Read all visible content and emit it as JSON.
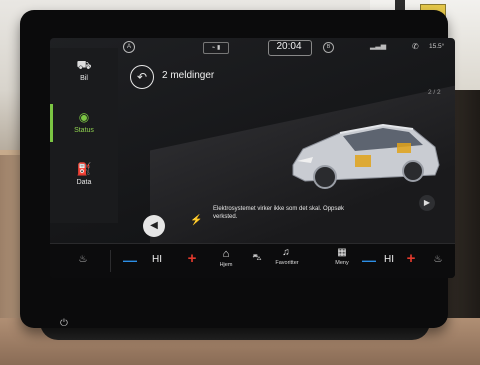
{
  "sidebar": {
    "items": [
      {
        "label": "Bil",
        "icon": "car-lift-icon"
      },
      {
        "label": "Status",
        "icon": "status-car-icon"
      },
      {
        "label": "Data",
        "icon": "data-icon"
      }
    ]
  },
  "status_bar": {
    "left_badge": "A",
    "clock": "20:04",
    "right_badge": "B",
    "outside_temp": "15.5°"
  },
  "header": {
    "title": "2 meldinger",
    "pager": "2 / 2"
  },
  "warning": {
    "text": "Elektrosystemet virker ikke som det skal. Oppsøk verksted."
  },
  "bottom_bar": {
    "left_fan": "HI",
    "right_fan": "HI",
    "home_label": "Hjem",
    "favorites_label": "Favoritter",
    "menu_label": "Meny"
  },
  "colors": {
    "accent_green": "#7bc543",
    "warning_amber": "#e0a21a",
    "minus_blue": "#2d8fe6",
    "plus_red": "#e23a2d"
  }
}
